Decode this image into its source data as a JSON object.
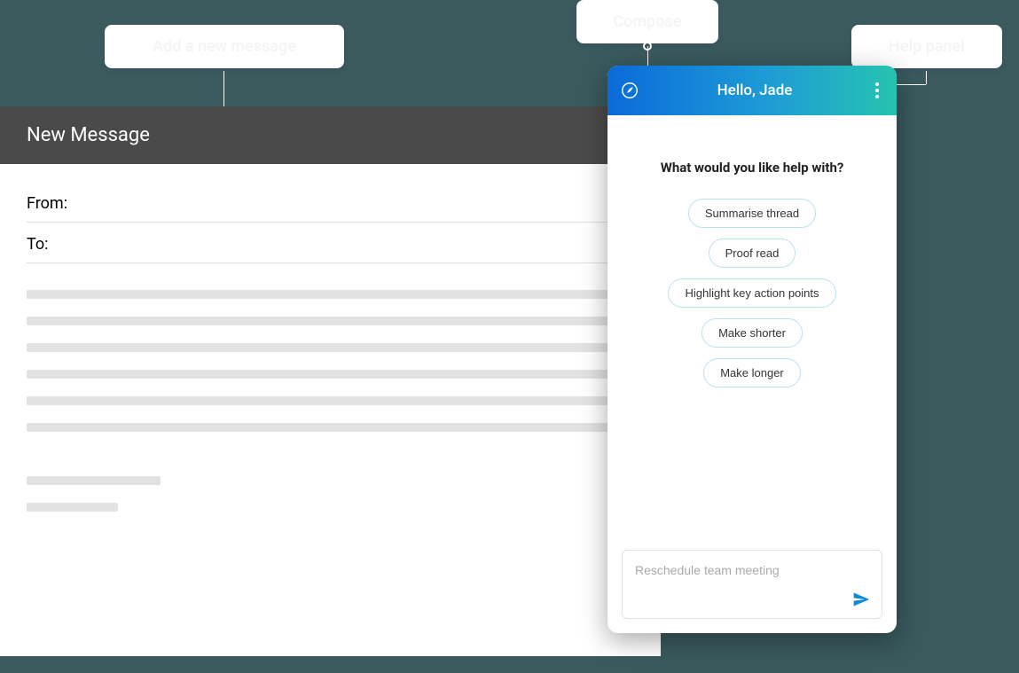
{
  "callouts": {
    "c1": "Add a new message",
    "c2": "Compose",
    "c3": "Help panel"
  },
  "compose": {
    "title": "New Message",
    "from_label": "From:",
    "to_label": "To:"
  },
  "assistant": {
    "greeting": "Hello, Jade",
    "prompt": "What would you like help with?",
    "chips": {
      "c0": "Summarise thread",
      "c1": "Proof read",
      "c2": "Highlight key action points",
      "c3": "Make shorter",
      "c4": "Make longer"
    },
    "input_placeholder": "Reschedule team meeting"
  }
}
